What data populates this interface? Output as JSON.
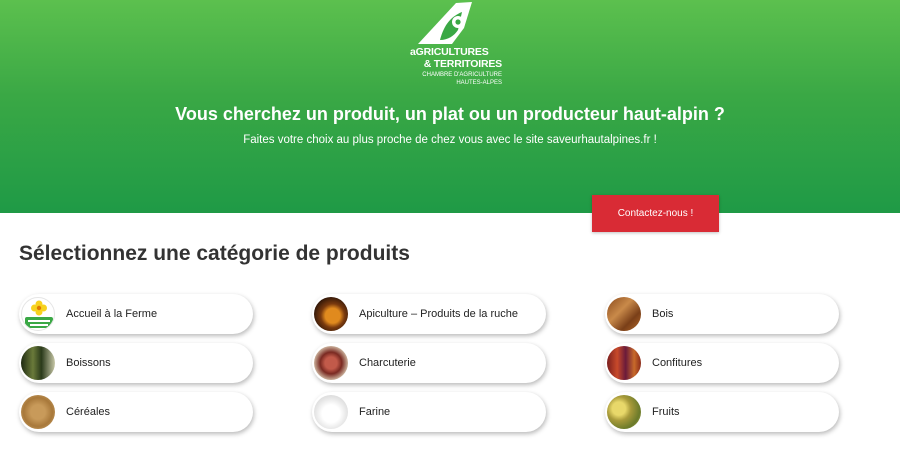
{
  "header": {
    "logo": {
      "line1": "aGRICULTURES",
      "line2": "& TERRITOIRES",
      "line3": "CHAMBRE D'AGRICULTURE",
      "line4": "HAUTES-ALPES"
    },
    "title": "Vous cherchez un produit, un plat ou un producteur haut-alpin ?",
    "subtitle": "Faites votre choix au plus proche de chez vous avec le site saveurhautalpines.fr !",
    "contact_label": "Contactez-nous !"
  },
  "section_title": "Sélectionnez une catégorie de produits",
  "categories": [
    {
      "label": "Accueil à la Ferme",
      "icon": "bienvenue-a-la-ferme-logo"
    },
    {
      "label": "Apiculture – Produits de la ruche",
      "icon": "honey-photo"
    },
    {
      "label": "Bois",
      "icon": "wood-photo"
    },
    {
      "label": "Boissons",
      "icon": "bottles-photo"
    },
    {
      "label": "Charcuterie",
      "icon": "charcuterie-photo"
    },
    {
      "label": "Confitures",
      "icon": "jam-jars-photo"
    },
    {
      "label": "Céréales",
      "icon": "grains-photo"
    },
    {
      "label": "Farine",
      "icon": "flour-photo"
    },
    {
      "label": "Fruits",
      "icon": "fruits-photo"
    }
  ],
  "colors": {
    "header_green": "#3aa845",
    "contact_red": "#d92b35",
    "title_text": "#333333"
  }
}
